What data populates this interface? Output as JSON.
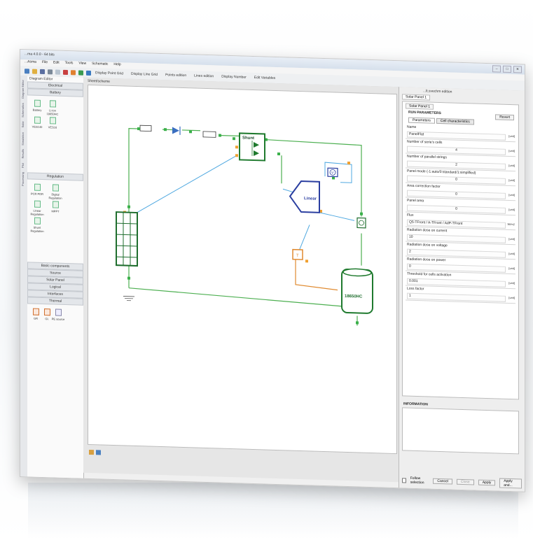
{
  "window": {
    "title": "...ma 4.0.0 - 64 bits",
    "buttons": [
      "–",
      "□",
      "✕"
    ]
  },
  "menu": [
    "...Asma",
    "File",
    "Edit",
    "Tools",
    "View",
    "Schematic",
    "Help"
  ],
  "toolbar": {
    "labels": [
      "Display Point Grid",
      "Display Line Grid",
      "Points edition",
      "Lines edition",
      "Display Number",
      "Edit Variables"
    ]
  },
  "left_strip": [
    "Diagram Editor",
    "Schematics",
    "Solar",
    "Simulation",
    "Results",
    "Plot",
    "Processing"
  ],
  "palette": {
    "header": "Diagram Editor",
    "sections": {
      "electrical": "Electrical",
      "battery": "Battery",
      "regulation": "Regulation",
      "basic": "Basic components",
      "source": "Source",
      "solar_panel": "Solar Panel",
      "logical": "Logical",
      "interfaces": "Interfaces",
      "thermal": "Thermal"
    },
    "battery_items": [
      "Battery",
      "Li-Ion 18650HC",
      "VES140",
      "VES16"
    ],
    "regulation_items": [
      "PCR PDR",
      "Digital Regulation",
      "Linear Regulation",
      "MPPT",
      "Shunt Regulation"
    ],
    "thermal_items": [
      "GR",
      "GL",
      "PE source"
    ]
  },
  "canvas": {
    "tab": "Sheet/scheme",
    "components": {
      "shunt": "Shunt",
      "linear": "Linear",
      "battery_cell": "18650HC",
      "voltmeter": "V",
      "thermo": "T"
    }
  },
  "properties": {
    "title": "...lt.svechm edition",
    "tab": "Solar Panel 1",
    "subtab": "Solar Panel 1",
    "section": "RUN PARAMETERS",
    "revert": "Revert",
    "param_tabs": [
      "Parameters",
      "Cell characteristics"
    ],
    "params": [
      {
        "label": "Name",
        "value": "PanelFlat",
        "unit": "[unit]"
      },
      {
        "label": "Number of serie's cells",
        "value": "4",
        "unit": "[unit]"
      },
      {
        "label": "Number of parallel strings",
        "value": "2",
        "unit": "[unit]"
      },
      {
        "label": "Panel mode (-1:auto/0:standard/1:simplified)",
        "value": "0",
        "unit": "[unit]"
      },
      {
        "label": "Area correction factor",
        "value": "0",
        "unit": "[unit]"
      },
      {
        "label": "Panel area",
        "value": "0",
        "unit": "[unit]"
      },
      {
        "label": "Flux",
        "value": "Q5-TFront / A-TFront / AdP-TFront",
        "unit": "W/m2"
      },
      {
        "label": "Radiation dose on current",
        "value": "10",
        "unit": "[unit]"
      },
      {
        "label": "Radiation dose on voltage",
        "value": "2",
        "unit": "[unit]"
      },
      {
        "label": "Radiation dose on power",
        "value": "0",
        "unit": "[unit]"
      },
      {
        "label": "Threshold for cells activation",
        "value": "0.001",
        "unit": "[unit]"
      },
      {
        "label": "Loss factor",
        "value": "1",
        "unit": "[unit]"
      }
    ],
    "information": "INFORMATION",
    "follow_selection": "Follow selection",
    "cancel": "Cancel",
    "close": "Close",
    "apply": "Apply",
    "apply_and_close": "Apply and..."
  }
}
